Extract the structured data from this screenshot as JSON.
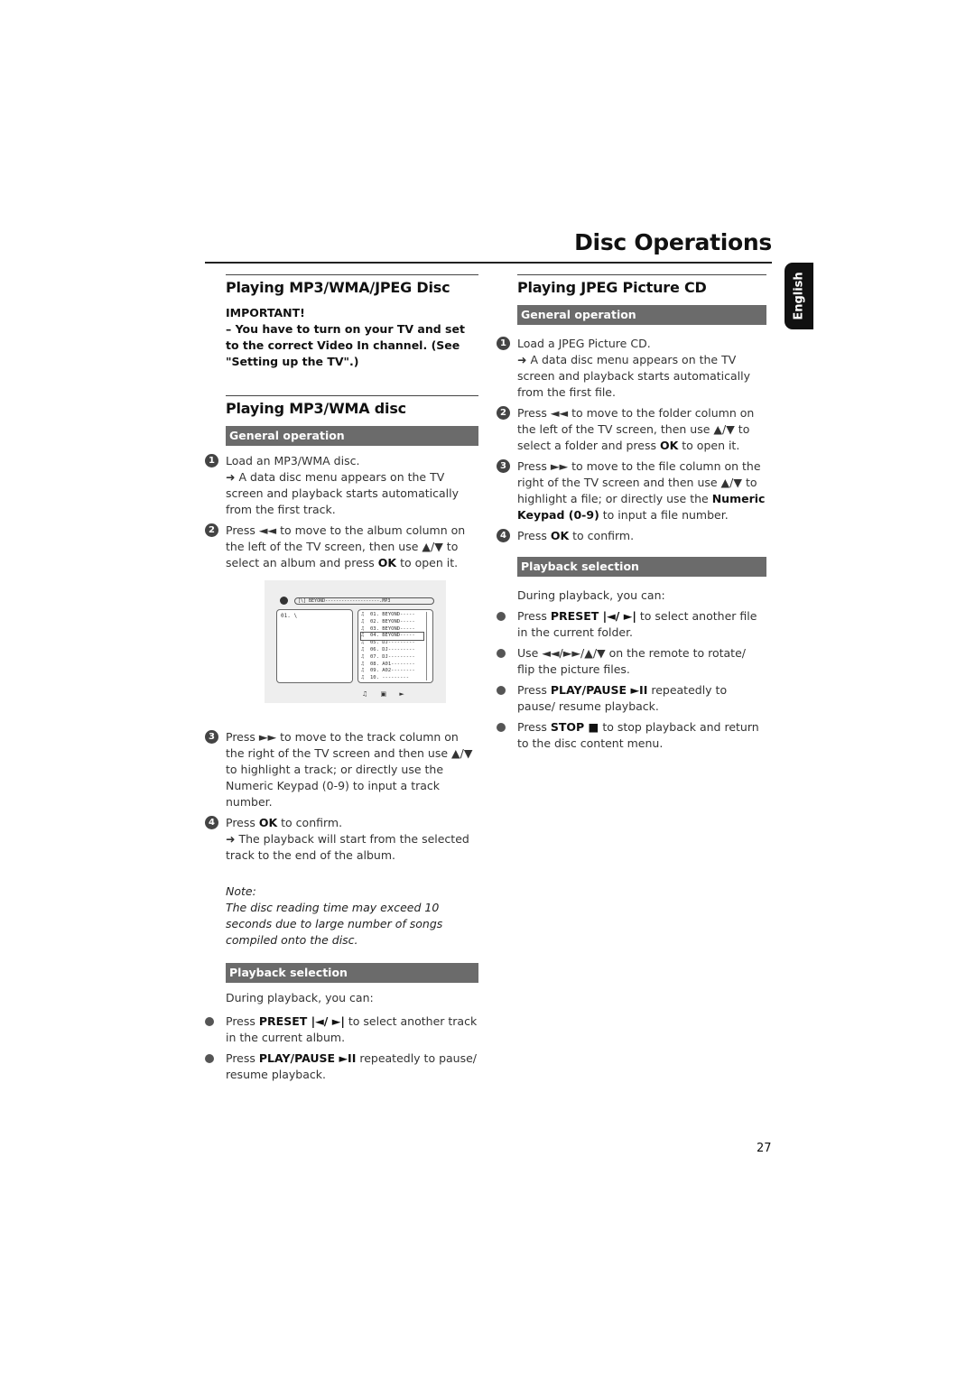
{
  "header": {
    "title": "Disc Operations",
    "language_tab": "English"
  },
  "left": {
    "section1_title": "Playing MP3/WMA/JPEG Disc",
    "important_label": "IMPORTANT!",
    "important_text": "–  You have to turn on your TV and set to the correct Video In channel. (See \"Setting up the TV\".)",
    "section2_title": "Playing MP3/WMA disc",
    "general_bar": "General operation",
    "steps": [
      {
        "num": "1",
        "text": "Load an MP3/WMA disc.",
        "sub": "➜ A data disc menu appears on the TV screen and playback starts automatically from the first track."
      },
      {
        "num": "2",
        "pre": "Press ◄◄  to move to the album column on the left of the TV screen, then use ▲/▼  to select an album and press ",
        "bold": "OK",
        "post": " to open it."
      },
      {
        "num": "3",
        "text": "Press ►► to move to the track column on the right of the TV screen and then use ▲/▼ to highlight a track; or directly use the Numeric Keypad (0-9) to input a track number."
      },
      {
        "num": "4",
        "pre": "Press ",
        "bold": "OK",
        "post": " to confirm.",
        "sub": "➜ The playback will start from the selected track to the end of the album."
      }
    ],
    "note_label": "Note:",
    "note_text": "The disc reading time may exceed 10 seconds due to large number of songs compiled onto the disc.",
    "playback_bar": "Playback selection",
    "playback_intro": "During playback, you can:",
    "bullets": [
      {
        "pre": "Press ",
        "bold": "PRESET  |◄/ ►|",
        "post": " to select another track in the current album."
      },
      {
        "pre": "Press ",
        "bold": "PLAY/PAUSE ►II",
        "post": "  repeatedly to pause/ resume playback."
      }
    ]
  },
  "screen": {
    "path": "[\\] BEYOND--------------------.MP3",
    "folder": "01.  \\",
    "tracks": [
      {
        "n": "01.",
        "name": "BEYOND-----",
        "selected": false
      },
      {
        "n": "02.",
        "name": "BEYOND-----",
        "selected": false
      },
      {
        "n": "03.",
        "name": "BEYOND-----",
        "selected": false
      },
      {
        "n": "04.",
        "name": "BEYOND-----",
        "selected": true
      },
      {
        "n": "05.",
        "name": "DJ---------",
        "selected": false
      },
      {
        "n": "06.",
        "name": "DJ---------",
        "selected": false
      },
      {
        "n": "07.",
        "name": "DJ---------",
        "selected": false
      },
      {
        "n": "08.",
        "name": "A01--------",
        "selected": false
      },
      {
        "n": "09.",
        "name": "A02--------",
        "selected": false
      },
      {
        "n": "10.",
        "name": "  ---------",
        "selected": false
      }
    ],
    "bottom_icons": "♫ ▣ ►"
  },
  "right": {
    "section_title": "Playing JPEG Picture CD",
    "general_bar": "General operation",
    "steps": [
      {
        "num": "1",
        "text": "Load a JPEG Picture CD.",
        "sub": "➜ A data disc menu appears on the TV screen and playback starts automatically from the first file."
      },
      {
        "num": "2",
        "pre": "Press ◄◄  to move to the folder column on the left of the TV screen, then use ▲/▼ to select a folder and press ",
        "bold": "OK",
        "post": " to open it."
      },
      {
        "num": "3",
        "pre": "Press ►► to move to the file column on the right of the TV screen and then use ▲/▼ to highlight a file; or directly use the ",
        "bold": "Numeric Keypad (0-9)",
        "post": " to input a file number."
      },
      {
        "num": "4",
        "pre": "Press ",
        "bold": "OK",
        "post": " to confirm."
      }
    ],
    "playback_bar": "Playback selection",
    "playback_intro": "During playback, you can:",
    "bullets": [
      {
        "pre": "Press ",
        "bold": "PRESET  |◄/ ►|",
        "post": " to select another file in the current folder."
      },
      {
        "pre": "Use ◄◄/►►/▲/▼ on the remote to rotate/ flip the picture files.",
        "bold": "",
        "post": ""
      },
      {
        "pre": "Press ",
        "bold": "PLAY/PAUSE ►II",
        "post": "  repeatedly to pause/ resume playback."
      },
      {
        "pre": "Press ",
        "bold": "STOP ■",
        "post": " to stop playback and return to the disc content menu."
      }
    ]
  },
  "footer": {
    "page_number": "27"
  }
}
